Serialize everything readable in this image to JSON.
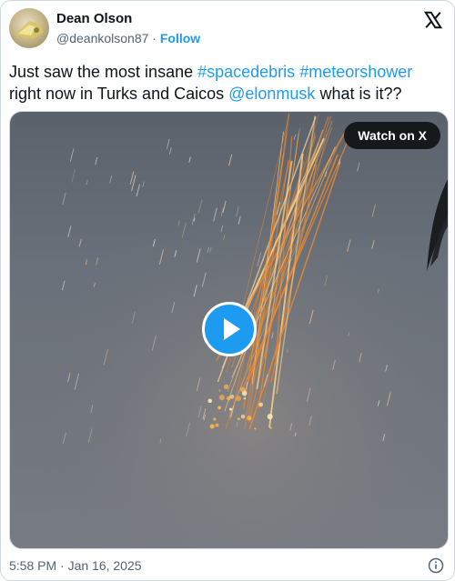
{
  "author": {
    "name": "Dean Olson",
    "handle": "@deankolson87",
    "separator": " · ",
    "follow_label": "Follow"
  },
  "tweet": {
    "segments": [
      {
        "text": "Just saw the most insane ",
        "link": false
      },
      {
        "text": "#spacedebris",
        "link": true
      },
      {
        "text": " ",
        "link": false
      },
      {
        "text": "#meteorshower",
        "link": true
      },
      {
        "text": " right now in Turks and Caicos ",
        "link": false
      },
      {
        "text": "@elonmusk",
        "link": true
      },
      {
        "text": " what is it??",
        "link": false
      }
    ]
  },
  "media": {
    "watch_label": "Watch on X",
    "play_icon": "play-icon"
  },
  "footer": {
    "timestamp": "5:58 PM · Jan 16, 2025",
    "info_icon": "info-icon"
  },
  "icons": {
    "brand": "x-logo-icon"
  },
  "colors": {
    "link": "#1d9bf0",
    "text": "#0f1419",
    "muted": "#536471",
    "streak": "#f08a2c"
  }
}
